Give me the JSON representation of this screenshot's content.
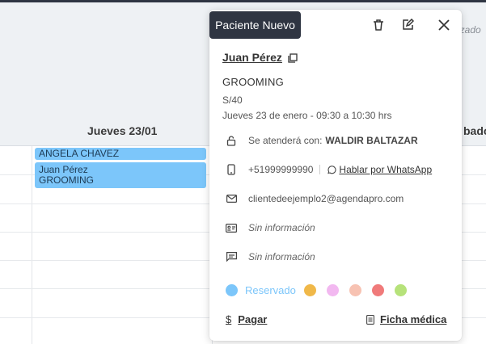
{
  "calendar": {
    "header_day": "Jueves 23/01",
    "header_right": "bado",
    "faded_right": "izado",
    "events": [
      {
        "label": "ANGELA CHAVEZ"
      },
      {
        "name": "Juan Pérez",
        "service": "GROOMING"
      }
    ]
  },
  "popover": {
    "tag": "Paciente Nuevo",
    "patient_name": "Juan Pérez",
    "service": "GROOMING",
    "price": "S/40",
    "date_time": "Jueves 23 de enero - 09:30 a 10:30 hrs",
    "attended_prefix": "Se atenderá con:",
    "attended_name": "WALDIR BALTAZAR",
    "phone": "+51999999990",
    "whatsapp_label": "Hablar por WhatsApp",
    "email": "clientedeejemplo2@agendapro.com",
    "id_info": "Sin información",
    "notes_info": "Sin información",
    "status_label": "Reservado",
    "status_colors": [
      "#7cc6fa",
      "#f0b849",
      "#f2b8f0",
      "#f7c2b2",
      "#f07a7a",
      "#b6e27a"
    ],
    "pay_label": "Pagar",
    "medical_label": "Ficha médica"
  }
}
